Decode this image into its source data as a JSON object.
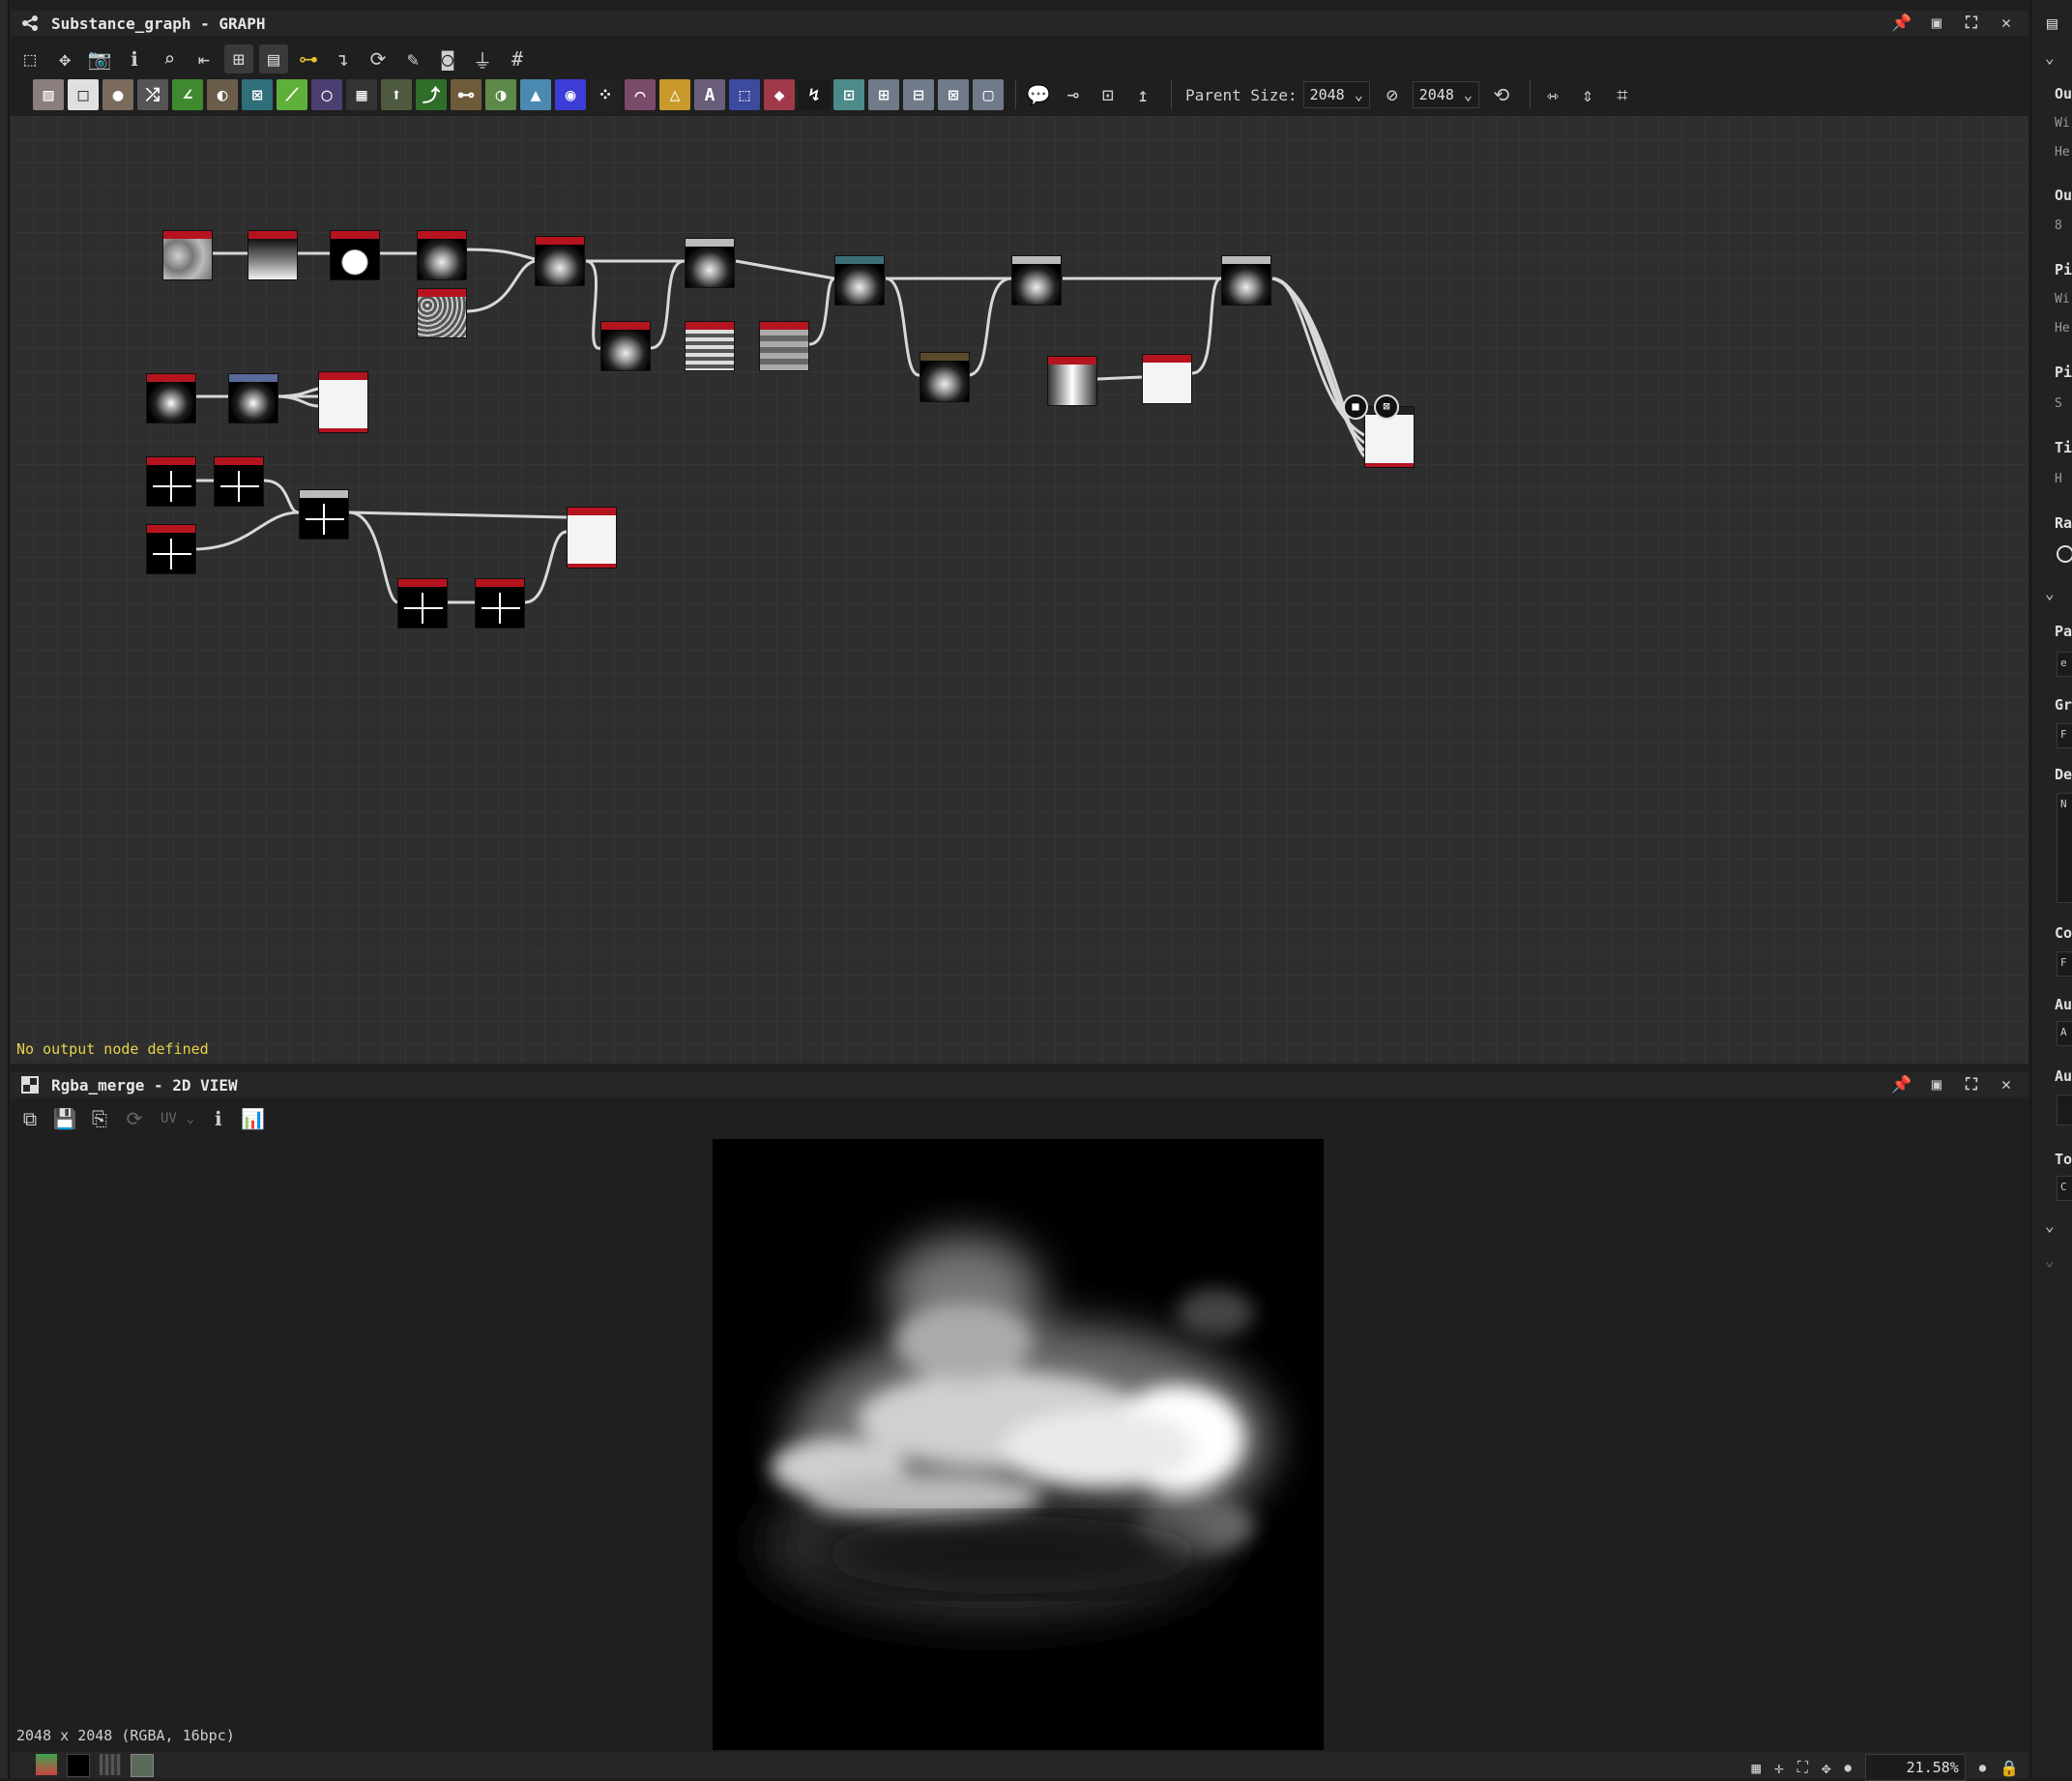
{
  "graph_panel": {
    "title": "Substance_graph - GRAPH",
    "parent_size_label": "Parent Size:",
    "parent_size_value": "2048",
    "size_value_2": "2048",
    "status": "No output node defined",
    "icons": [
      "layout-icon",
      "pan-icon",
      "camera-icon",
      "info-icon",
      "search-icon",
      "align-icon",
      "hierarchy-icon",
      "frame-icon",
      "connect-icon",
      "elbow-icon",
      "reset-icon",
      "tool-icon",
      "snapshot-icon",
      "weight-icon",
      "grid-icon"
    ],
    "atomic_nodes": [
      "bitmap",
      "uniform-color",
      "blur",
      "transform",
      "curve",
      "gradient",
      "warp",
      "level",
      "hsl",
      "shape",
      "blend",
      "fx-map",
      "distance",
      "directional-warp",
      "emboss",
      "gradient-map",
      "pixel-processor",
      "text",
      "svg",
      "grayscale",
      "pixel-01",
      "normal",
      "height-blend",
      "sharpen",
      "levels-2",
      "material-blend"
    ]
  },
  "view_panel": {
    "title": "Rgba_merge - 2D VIEW",
    "uv_label": "UV",
    "resolution": "2048 x 2048 (RGBA, 16bpc)"
  },
  "bottom_bar": {
    "zoom": "21.58%"
  },
  "sidebar": {
    "labels": [
      "Ou",
      "Wi",
      "He",
      "Ou",
      "8",
      "Pi",
      "Wi",
      "He",
      "Pi",
      "S",
      "Ti",
      "H",
      "Ra",
      "Pa",
      "e",
      "Gr",
      "F",
      "De",
      "N",
      "Co",
      "F",
      "Au",
      "A",
      "Au",
      "To",
      "C"
    ]
  },
  "colors": {
    "node_header_red": "#b5141f",
    "graph_bg": "#2e2e2e",
    "status_yellow": "#e8d24a"
  }
}
